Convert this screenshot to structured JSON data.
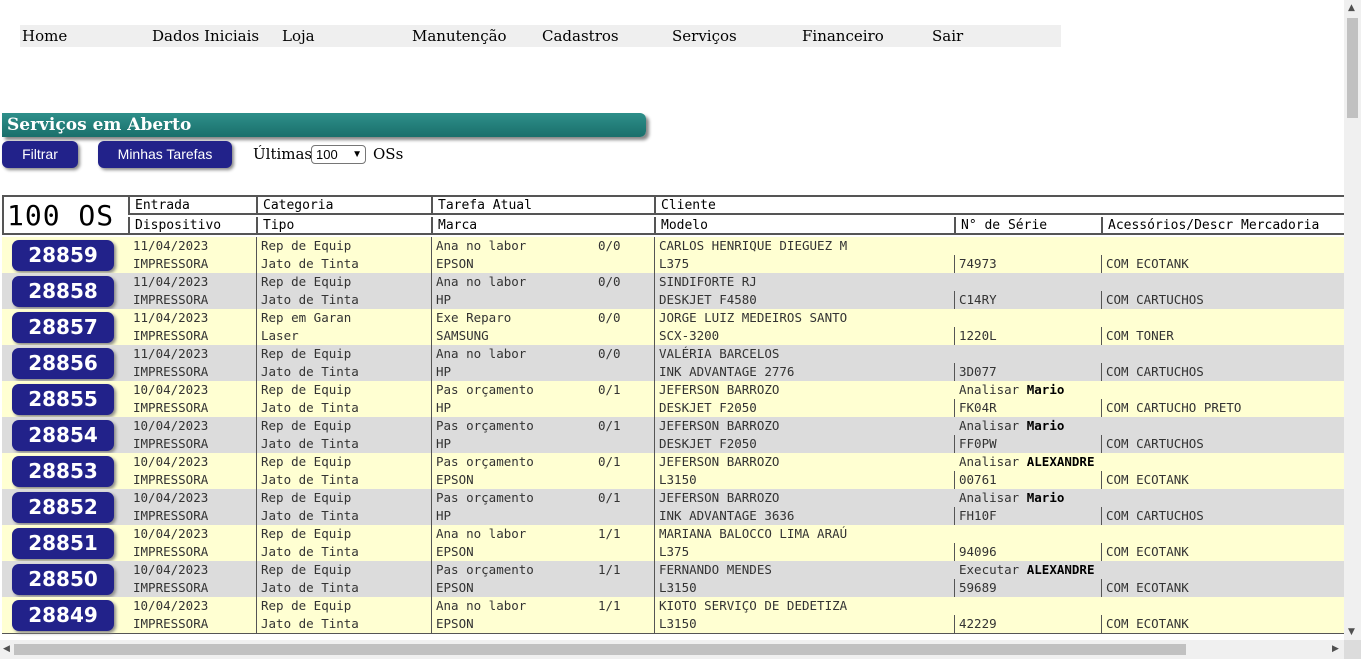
{
  "menu": [
    "Home",
    "Dados Iniciais",
    "Loja",
    "Manutenção",
    "Cadastros",
    "Serviços",
    "Financeiro",
    "Sair"
  ],
  "section_title": "Serviços em Aberto",
  "buttons": {
    "filtrar": "Filtrar",
    "minhas_tarefas": "Minhas Tarefas"
  },
  "filter": {
    "ultimas_label": "Últimas",
    "selected": "100",
    "oss_label": "OSs"
  },
  "table": {
    "count_label": "100 OS",
    "headers_row1": [
      "Entrada",
      "Categoria",
      "Tarefa Atual",
      "Cliente"
    ],
    "headers_row2": [
      "Dispositivo",
      "Tipo",
      "Marca",
      "Modelo",
      "N° de Série",
      "Acessórios/Descr Mercadoria"
    ],
    "rows": [
      {
        "os": "28859",
        "entrada": "11/04/2023",
        "categoria": "Rep de Equip",
        "tarefa": "Ana no labor",
        "progress": "0/0",
        "cliente": "CARLOS HENRIQUE DIEGUEZ M",
        "acao": "",
        "resp": "",
        "dispositivo": "IMPRESSORA",
        "tipo": "Jato de Tinta",
        "marca": "EPSON",
        "modelo": "L375",
        "serie": "74973",
        "acessorios": "COM ECOTANK"
      },
      {
        "os": "28858",
        "entrada": "11/04/2023",
        "categoria": "Rep de Equip",
        "tarefa": "Ana no labor",
        "progress": "0/0",
        "cliente": "SINDIFORTE RJ",
        "acao": "",
        "resp": "",
        "dispositivo": "IMPRESSORA",
        "tipo": "Jato de Tinta",
        "marca": "HP",
        "modelo": "DESKJET F4580",
        "serie": "C14RY",
        "acessorios": "COM CARTUCHOS"
      },
      {
        "os": "28857",
        "entrada": "11/04/2023",
        "categoria": "Rep em Garan",
        "tarefa": "Exe Reparo",
        "progress": "0/0",
        "cliente": "JORGE LUIZ MEDEIROS SANTO",
        "acao": "",
        "resp": "",
        "dispositivo": "IMPRESSORA",
        "tipo": "Laser",
        "marca": "SAMSUNG",
        "modelo": "SCX-3200",
        "serie": "1220L",
        "acessorios": "COM TONER"
      },
      {
        "os": "28856",
        "entrada": "11/04/2023",
        "categoria": "Rep de Equip",
        "tarefa": "Ana no labor",
        "progress": "0/0",
        "cliente": "VALÉRIA BARCELOS",
        "acao": "",
        "resp": "",
        "dispositivo": "IMPRESSORA",
        "tipo": "Jato de Tinta",
        "marca": "HP",
        "modelo": "INK ADVANTAGE 2776",
        "serie": "3D077",
        "acessorios": "COM CARTUCHOS"
      },
      {
        "os": "28855",
        "entrada": "10/04/2023",
        "categoria": "Rep de Equip",
        "tarefa": "Pas orçamento",
        "progress": "0/1",
        "cliente": "JEFERSON BARROZO",
        "acao": "Analisar",
        "resp": "Mario",
        "dispositivo": "IMPRESSORA",
        "tipo": "Jato de Tinta",
        "marca": "HP",
        "modelo": "DESKJET F2050",
        "serie": "FK04R",
        "acessorios": "COM CARTUCHO PRETO"
      },
      {
        "os": "28854",
        "entrada": "10/04/2023",
        "categoria": "Rep de Equip",
        "tarefa": "Pas orçamento",
        "progress": "0/1",
        "cliente": "JEFERSON BARROZO",
        "acao": "Analisar",
        "resp": "Mario",
        "dispositivo": "IMPRESSORA",
        "tipo": "Jato de Tinta",
        "marca": "HP",
        "modelo": "DESKJET F2050",
        "serie": "FF0PW",
        "acessorios": "COM CARTUCHOS"
      },
      {
        "os": "28853",
        "entrada": "10/04/2023",
        "categoria": "Rep de Equip",
        "tarefa": "Pas orçamento",
        "progress": "0/1",
        "cliente": "JEFERSON BARROZO",
        "acao": "Analisar",
        "resp": "ALEXANDRE",
        "dispositivo": "IMPRESSORA",
        "tipo": "Jato de Tinta",
        "marca": "EPSON",
        "modelo": "L3150",
        "serie": "00761",
        "acessorios": "COM ECOTANK"
      },
      {
        "os": "28852",
        "entrada": "10/04/2023",
        "categoria": "Rep de Equip",
        "tarefa": "Pas orçamento",
        "progress": "0/1",
        "cliente": "JEFERSON BARROZO",
        "acao": "Analisar",
        "resp": "Mario",
        "dispositivo": "IMPRESSORA",
        "tipo": "Jato de Tinta",
        "marca": "HP",
        "modelo": "INK ADVANTAGE 3636",
        "serie": "FH10F",
        "acessorios": "COM CARTUCHOS"
      },
      {
        "os": "28851",
        "entrada": "10/04/2023",
        "categoria": "Rep de Equip",
        "tarefa": "Ana no labor",
        "progress": "1/1",
        "cliente": "MARIANA BALOCCO LIMA ARAÚ",
        "acao": "",
        "resp": "",
        "dispositivo": "IMPRESSORA",
        "tipo": "Jato de Tinta",
        "marca": "EPSON",
        "modelo": "L375",
        "serie": "94096",
        "acessorios": "COM ECOTANK"
      },
      {
        "os": "28850",
        "entrada": "10/04/2023",
        "categoria": "Rep de Equip",
        "tarefa": "Pas orçamento",
        "progress": "1/1",
        "cliente": "FERNANDO MENDES",
        "acao": "Executar",
        "resp": "ALEXANDRE",
        "dispositivo": "IMPRESSORA",
        "tipo": "Jato de Tinta",
        "marca": "EPSON",
        "modelo": "L3150",
        "serie": "59689",
        "acessorios": "COM ECOTANK"
      },
      {
        "os": "28849",
        "entrada": "10/04/2023",
        "categoria": "Rep de Equip",
        "tarefa": "Ana no labor",
        "progress": "1/1",
        "cliente": "KIOTO SERVIÇO DE DEDETIZA",
        "acao": "",
        "resp": "",
        "dispositivo": "IMPRESSORA",
        "tipo": "Jato de Tinta",
        "marca": "EPSON",
        "modelo": "L3150",
        "serie": "42229",
        "acessorios": "COM ECOTANK"
      }
    ]
  },
  "colors": {
    "button": "#22228a",
    "title_bar": "#1f7a75",
    "row_yellow": "#ffffd2",
    "row_gray": "#dcdcdc"
  }
}
